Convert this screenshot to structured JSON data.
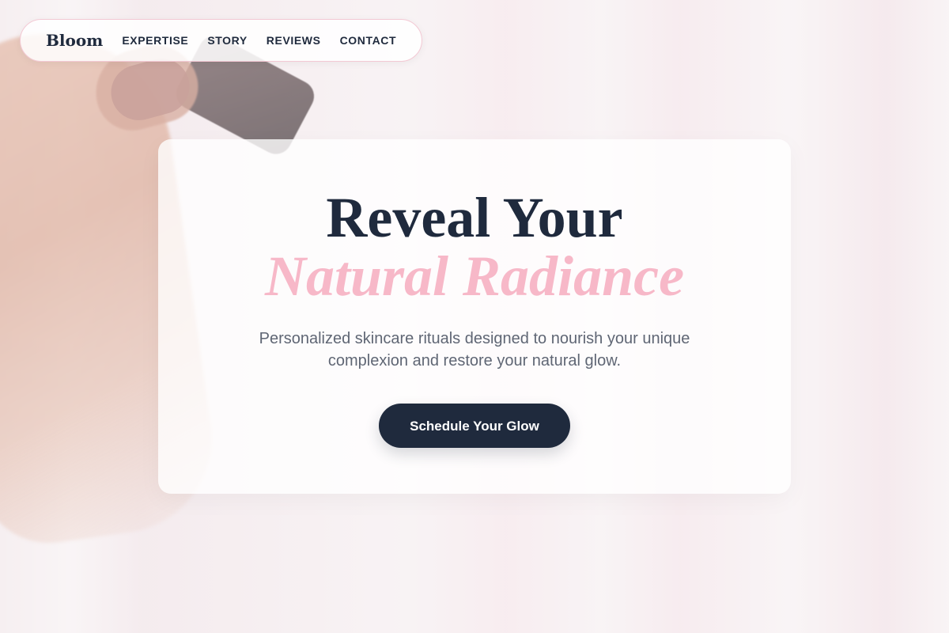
{
  "nav": {
    "brand": "Bloom",
    "links": [
      "EXPERTISE",
      "STORY",
      "REVIEWS",
      "CONTACT"
    ]
  },
  "hero": {
    "headline_line1": "Reveal Your",
    "headline_line2": "Natural Radiance",
    "subtext": "Personalized skincare rituals designed to nourish your unique complexion and restore your natural glow.",
    "cta_label": "Schedule Your Glow"
  },
  "colors": {
    "primary_dark": "#1f2a3d",
    "accent_pink": "#f7b8c8",
    "background": "#f6eff1"
  }
}
